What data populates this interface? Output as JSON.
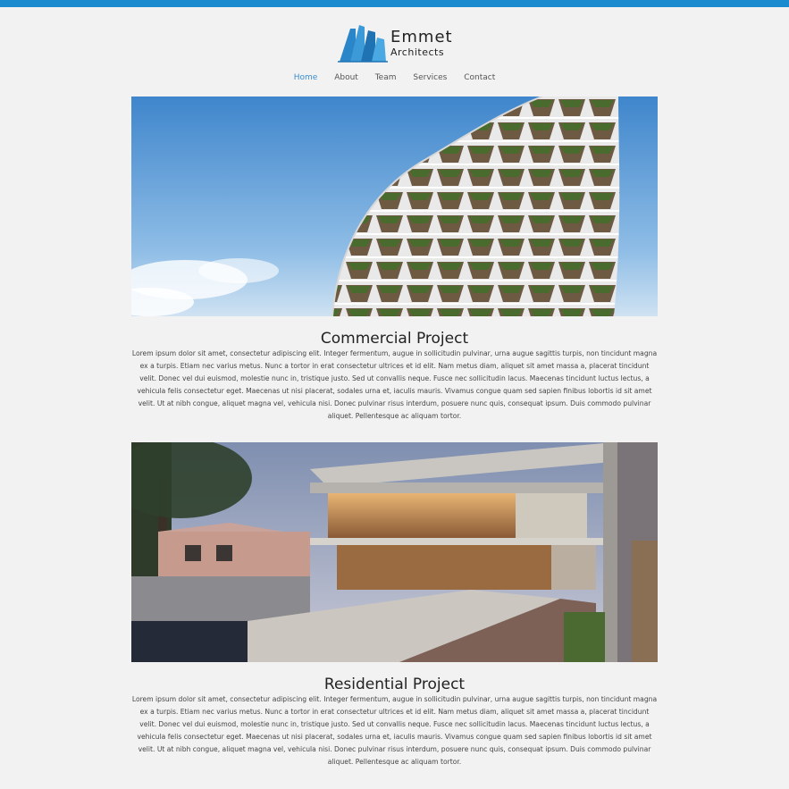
{
  "brand": {
    "name_line1": "Emmet",
    "name_line2": "Architects"
  },
  "nav": {
    "items": [
      {
        "label": "Home",
        "active": true
      },
      {
        "label": "About",
        "active": false
      },
      {
        "label": "Team",
        "active": false
      },
      {
        "label": "Services",
        "active": false
      },
      {
        "label": "Contact",
        "active": false
      }
    ]
  },
  "sections": [
    {
      "title": "Commercial Project",
      "body": "Lorem ipsum dolor sit amet, consectetur adipiscing elit. Integer fermentum, augue in sollicitudin pulvinar, urna augue sagittis turpis, non tincidunt magna ex a turpis. Etiam nec varius metus. Nunc a tortor in erat consectetur ultrices et id elit. Nam metus diam, aliquet sit amet massa a, placerat tincidunt velit. Donec vel dui euismod, molestie nunc in, tristique justo. Sed ut convallis neque. Fusce nec sollicitudin lacus. Maecenas tincidunt luctus lectus, a vehicula felis consectetur eget. Maecenas ut nisi placerat, sodales urna et, iaculis mauris. Vivamus congue quam sed sapien finibus lobortis id sit amet velit. Ut at nibh congue, aliquet magna vel, vehicula nisi. Donec pulvinar risus interdum, posuere nunc quis, consequat ipsum. Duis commodo pulvinar aliquet. Pellentesque ac aliquam tortor."
    },
    {
      "title": "Residential Project",
      "body": "Lorem ipsum dolor sit amet, consectetur adipiscing elit. Integer fermentum, augue in sollicitudin pulvinar, urna augue sagittis turpis, non tincidunt magna ex a turpis. Etiam nec varius metus. Nunc a tortor in erat consectetur ultrices et id elit. Nam metus diam, aliquet sit amet massa a, placerat tincidunt velit. Donec vel dui euismod, molestie nunc in, tristique justo. Sed ut convallis neque. Fusce nec sollicitudin lacus. Maecenas tincidunt luctus lectus, a vehicula felis consectetur eget. Maecenas ut nisi placerat, sodales urna et, iaculis mauris. Vivamus congue quam sed sapien finibus lobortis id sit amet velit. Ut at nibh congue, aliquet magna vel, vehicula nisi. Donec pulvinar risus interdum, posuere nunc quis, consequat ipsum. Duis commodo pulvinar aliquet. Pel­lentesque ac aliquam tortor."
    }
  ],
  "colors": {
    "accent": "#1b8bd0",
    "nav_active": "#3a8dd3",
    "background": "#f2f2f2"
  }
}
